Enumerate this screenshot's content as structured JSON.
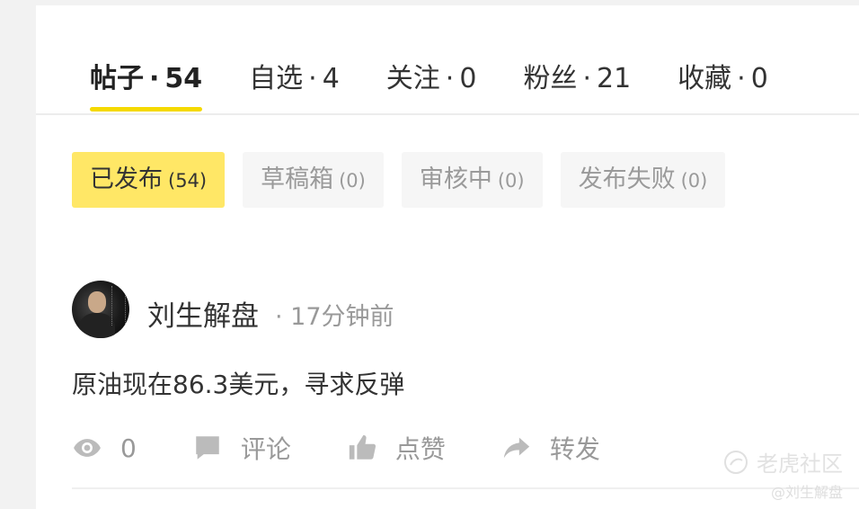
{
  "tabs": [
    {
      "label": "帖子",
      "count": "54",
      "active": true
    },
    {
      "label": "自选",
      "count": "4"
    },
    {
      "label": "关注",
      "count": "0"
    },
    {
      "label": "粉丝",
      "count": "21"
    },
    {
      "label": "收藏",
      "count": "0"
    }
  ],
  "tab_separator": "·",
  "chips": [
    {
      "label": "已发布",
      "count": "(54)"
    },
    {
      "label": "草稿箱",
      "count": "(0)"
    },
    {
      "label": "审核中",
      "count": "(0)"
    },
    {
      "label": "发布失败",
      "count": "(0)"
    }
  ],
  "post": {
    "author": "刘生解盘",
    "time": "· 17分钟前",
    "text": "原油现在86.3美元，寻求反弹",
    "views": "0",
    "comment_label": "评论",
    "like_label": "点赞",
    "share_label": "转发"
  },
  "watermark": {
    "brand": "老虎社区",
    "handle": "@刘生解盘"
  },
  "colors": {
    "accent_yellow": "#f5d900",
    "chip_active": "#ffe766"
  }
}
